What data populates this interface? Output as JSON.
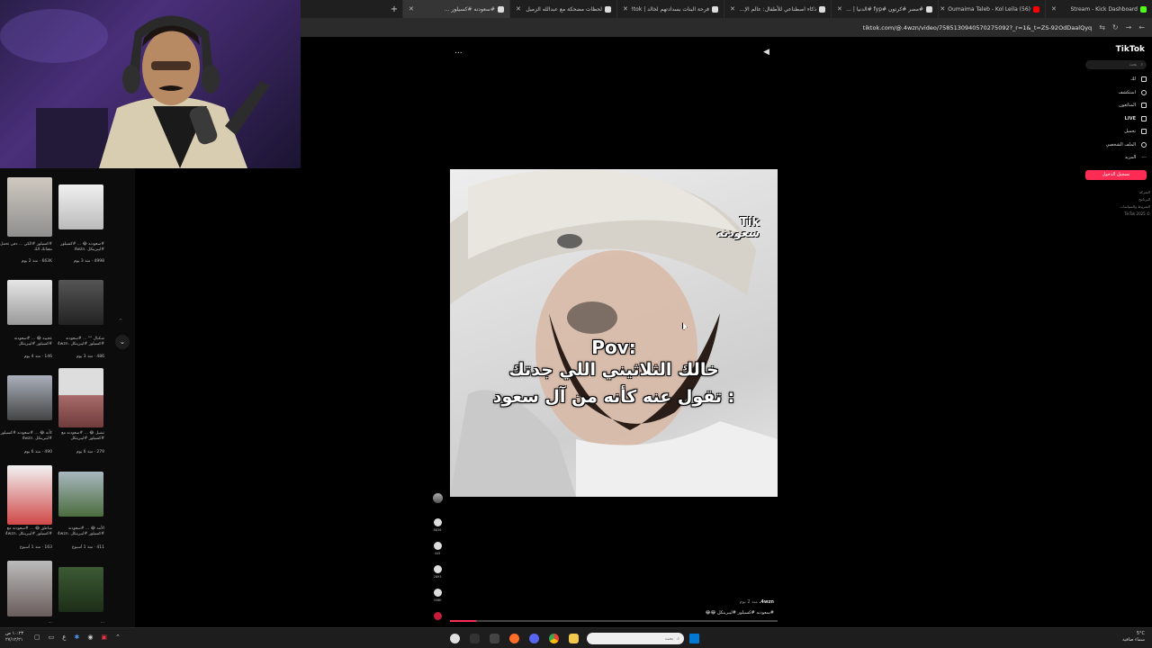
{
  "browser": {
    "tabs": [
      {
        "title": "Stream - Kick Dashboard",
        "active": false
      },
      {
        "title": "(56) Oumaima Taleb - Kol Leila",
        "active": false
      },
      {
        "title": "#مصر #كرتون #fyp #الدنيا | ...",
        "active": false
      },
      {
        "title": "ذكاء اصطناعي للأطفال: عالم الإ...",
        "active": false
      },
      {
        "title": "فرحة البنات بسدادتهم لخالد | tok!",
        "active": false
      },
      {
        "title": "لحظات مضحكة مع عبدالله الزميل",
        "active": false
      },
      {
        "title": "#سعودنه #كسيلور ...",
        "active": true
      }
    ],
    "url": "tiktok.com/@.4wzn/video/7585130940570275092?_r=1&_t=ZS-92OdDaalQyq"
  },
  "tiktok": {
    "logo": "TikTok",
    "search_placeholder": "بحث",
    "nav": [
      {
        "label": "لك",
        "icon": "home-icon"
      },
      {
        "label": "استكشف",
        "icon": "compass-icon"
      },
      {
        "label": "المتابَعون",
        "icon": "user-icon"
      },
      {
        "label": "LIVE",
        "icon": "live-icon"
      },
      {
        "label": "تحميل",
        "icon": "upload-icon"
      },
      {
        "label": "الملف الشخصي",
        "icon": "profile-icon"
      },
      {
        "label": "المزيد",
        "icon": "more-icon"
      }
    ],
    "login_button": "تسجيل الدخول",
    "footer_lines": [
      "الشركة",
      "البرنامج",
      "الشروط والسياسات",
      "TikTok 2025 ©"
    ],
    "video": {
      "watermark_line1": "Tik",
      "watermark_line2": "سعودنه",
      "overlay_line1": "Pov:",
      "overlay_line2": "خالك الثلاثيني اللي جدتك",
      "overlay_line3": "تقول عنه كأنه من آل سعود :"
    },
    "actions": {
      "likes": "8836",
      "comments": "445",
      "saves": "2893",
      "shares": "308K"
    },
    "author": "4wzn.",
    "posted": "منذ 2 يوم",
    "caption": "#سعودنه #كسيلور #ليبرينكل 😂😂",
    "more_button": "..."
  },
  "profile_grid": [
    {
      "caption": "#كسيلور #الكي ... دفي تحمل مفتاتك الك",
      "stats": "663K · منذ 2 يوم"
    },
    {
      "caption": "#سعودنه 😂 ... #كسيلور #ليبرينكل .4wzn",
      "stats": "4998 · منذ 3 يوم"
    },
    {
      "caption": "عجيبه 😂 ... #سعودنه #كسيلور #ليبرينكل",
      "stats": "146 · منذ 4 يوم"
    },
    {
      "caption": "شكبال °° ... #سعودنه #كسيلور #ليبرينكل .4wzn",
      "stats": "486 · منذ 3 يوم"
    },
    {
      "caption": "كأنه 😂 ... #سعودنه #كسيلور #ليبرينكل .4wzn",
      "stats": "490 · منذ 6 يوم"
    },
    {
      "caption": "تشيل 😂 ... #سعودنه مع #كسيلور #ليبرينكل",
      "stats": "279 · منذ 6 يوم"
    },
    {
      "caption": "مناطق 😂 ... #سعودنه مع #كسيلور #ليبرينكل .4wzn",
      "stats": "163 · منذ 1 أسبوع"
    },
    {
      "caption": "الأمد 😂 ... #سعودنه #كسيلور #ليبرينكل .4wzn",
      "stats": "411 · منذ 1 أسبوع"
    },
    {
      "caption": "...",
      "stats": "منذ 1 أسبوع"
    },
    {
      "caption": "...",
      "stats": "منذ 1 أسبوع"
    }
  ],
  "taskbar": {
    "search_placeholder": "بحث",
    "weather_temp": "5°C",
    "weather_desc": "سماء صافية",
    "time": "١٠:٢٣ ص",
    "date": "٢٧/١٢/٢١",
    "lang": "ع"
  },
  "colors": {
    "accent": "#fe2c55",
    "chrome_bg": "#1f1f1f",
    "active_tab": "#353535"
  }
}
